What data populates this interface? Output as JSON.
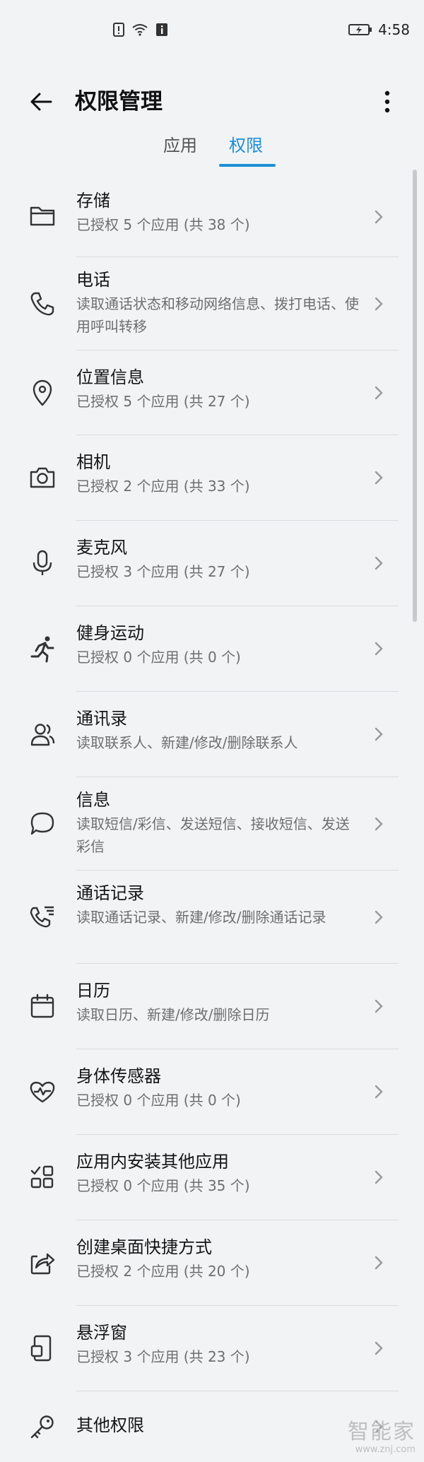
{
  "status_bar": {
    "time": "4:58",
    "icons": [
      "alert-icon",
      "wifi-icon",
      "info-icon",
      "battery-charging-icon"
    ]
  },
  "header": {
    "title": "权限管理",
    "back_icon": "back-arrow-icon",
    "more_icon": "more-vertical-icon"
  },
  "tabs": [
    {
      "label": "应用",
      "active": false
    },
    {
      "label": "权限",
      "active": true
    }
  ],
  "colors": {
    "accent": "#1c8fd6",
    "background": "#f1f3f5",
    "primary_text": "#151515",
    "secondary_text": "#6e6e6e"
  },
  "permissions": [
    {
      "icon": "folder-icon",
      "label": "存储",
      "desc": "已授权 5 个应用 (共 38 个)"
    },
    {
      "icon": "phone-icon",
      "label": "电话",
      "desc": "读取通话状态和移动网络信息、拨打电话、使用呼叫转移"
    },
    {
      "icon": "location-pin-icon",
      "label": "位置信息",
      "desc": "已授权 5 个应用 (共 27 个)"
    },
    {
      "icon": "camera-icon",
      "label": "相机",
      "desc": "已授权 2 个应用 (共 33 个)"
    },
    {
      "icon": "microphone-icon",
      "label": "麦克风",
      "desc": "已授权 3 个应用 (共 27 个)"
    },
    {
      "icon": "running-icon",
      "label": "健身运动",
      "desc": "已授权 0 个应用 (共 0 个)"
    },
    {
      "icon": "contacts-icon",
      "label": "通讯录",
      "desc": "读取联系人、新建/修改/删除联系人"
    },
    {
      "icon": "message-bubble-icon",
      "label": "信息",
      "desc": "读取短信/彩信、发送短信、接收短信、发送彩信"
    },
    {
      "icon": "call-log-icon",
      "label": "通话记录",
      "desc": "读取通话记录、新建/修改/删除通话记录"
    },
    {
      "icon": "calendar-icon",
      "label": "日历",
      "desc": "读取日历、新建/修改/删除日历"
    },
    {
      "icon": "heart-pulse-icon",
      "label": "身体传感器",
      "desc": "已授权 0 个应用 (共 0 个)"
    },
    {
      "icon": "app-grid-icon",
      "label": "应用内安装其他应用",
      "desc": "已授权 0 个应用 (共 35 个)"
    },
    {
      "icon": "shortcut-share-icon",
      "label": "创建桌面快捷方式",
      "desc": "已授权 2 个应用 (共 20 个)"
    },
    {
      "icon": "floating-window-icon",
      "label": "悬浮窗",
      "desc": "已授权 3 个应用 (共 23 个)"
    },
    {
      "icon": "key-icon",
      "label": "其他权限",
      "desc": ""
    }
  ],
  "watermark": {
    "text": "智能家",
    "url": "www.znj.com"
  }
}
